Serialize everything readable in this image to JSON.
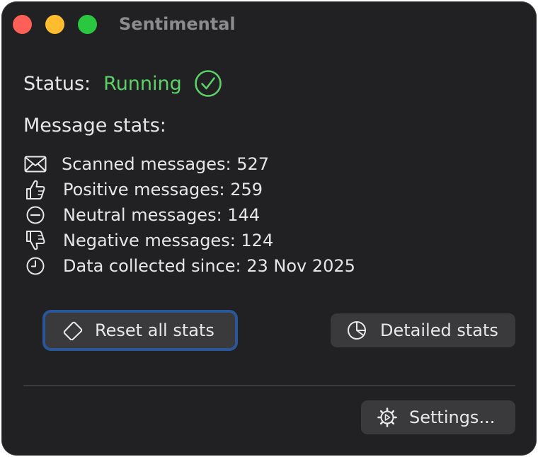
{
  "window": {
    "title": "Sentimental",
    "buttons": [
      "close",
      "minimize",
      "zoom"
    ]
  },
  "status": {
    "label": "Status:",
    "value": "Running",
    "icon": "checkmark-circle-icon",
    "color": "#5cd167"
  },
  "stats": {
    "title": "Message stats:",
    "items": [
      {
        "icon": "envelope-icon",
        "text": "Scanned messages: 527"
      },
      {
        "icon": "thumbs-up-icon",
        "text": "Positive messages: 259"
      },
      {
        "icon": "minus-circle-icon",
        "text": "Neutral messages: 144"
      },
      {
        "icon": "thumbs-down-icon",
        "text": "Negative messages: 124"
      },
      {
        "icon": "clock-icon",
        "text": "Data collected since: 23 Nov 2025"
      }
    ]
  },
  "actions": {
    "reset_label": "Reset all stats",
    "reset_icon": "eraser-icon",
    "detailed_label": "Detailed stats",
    "detailed_icon": "pie-chart-icon",
    "settings_label": "Settings...",
    "settings_icon": "gear-icon"
  },
  "colors": {
    "window_bg": "#212123",
    "button_bg": "#3a3a3c",
    "focus_ring": "#2b5798"
  }
}
